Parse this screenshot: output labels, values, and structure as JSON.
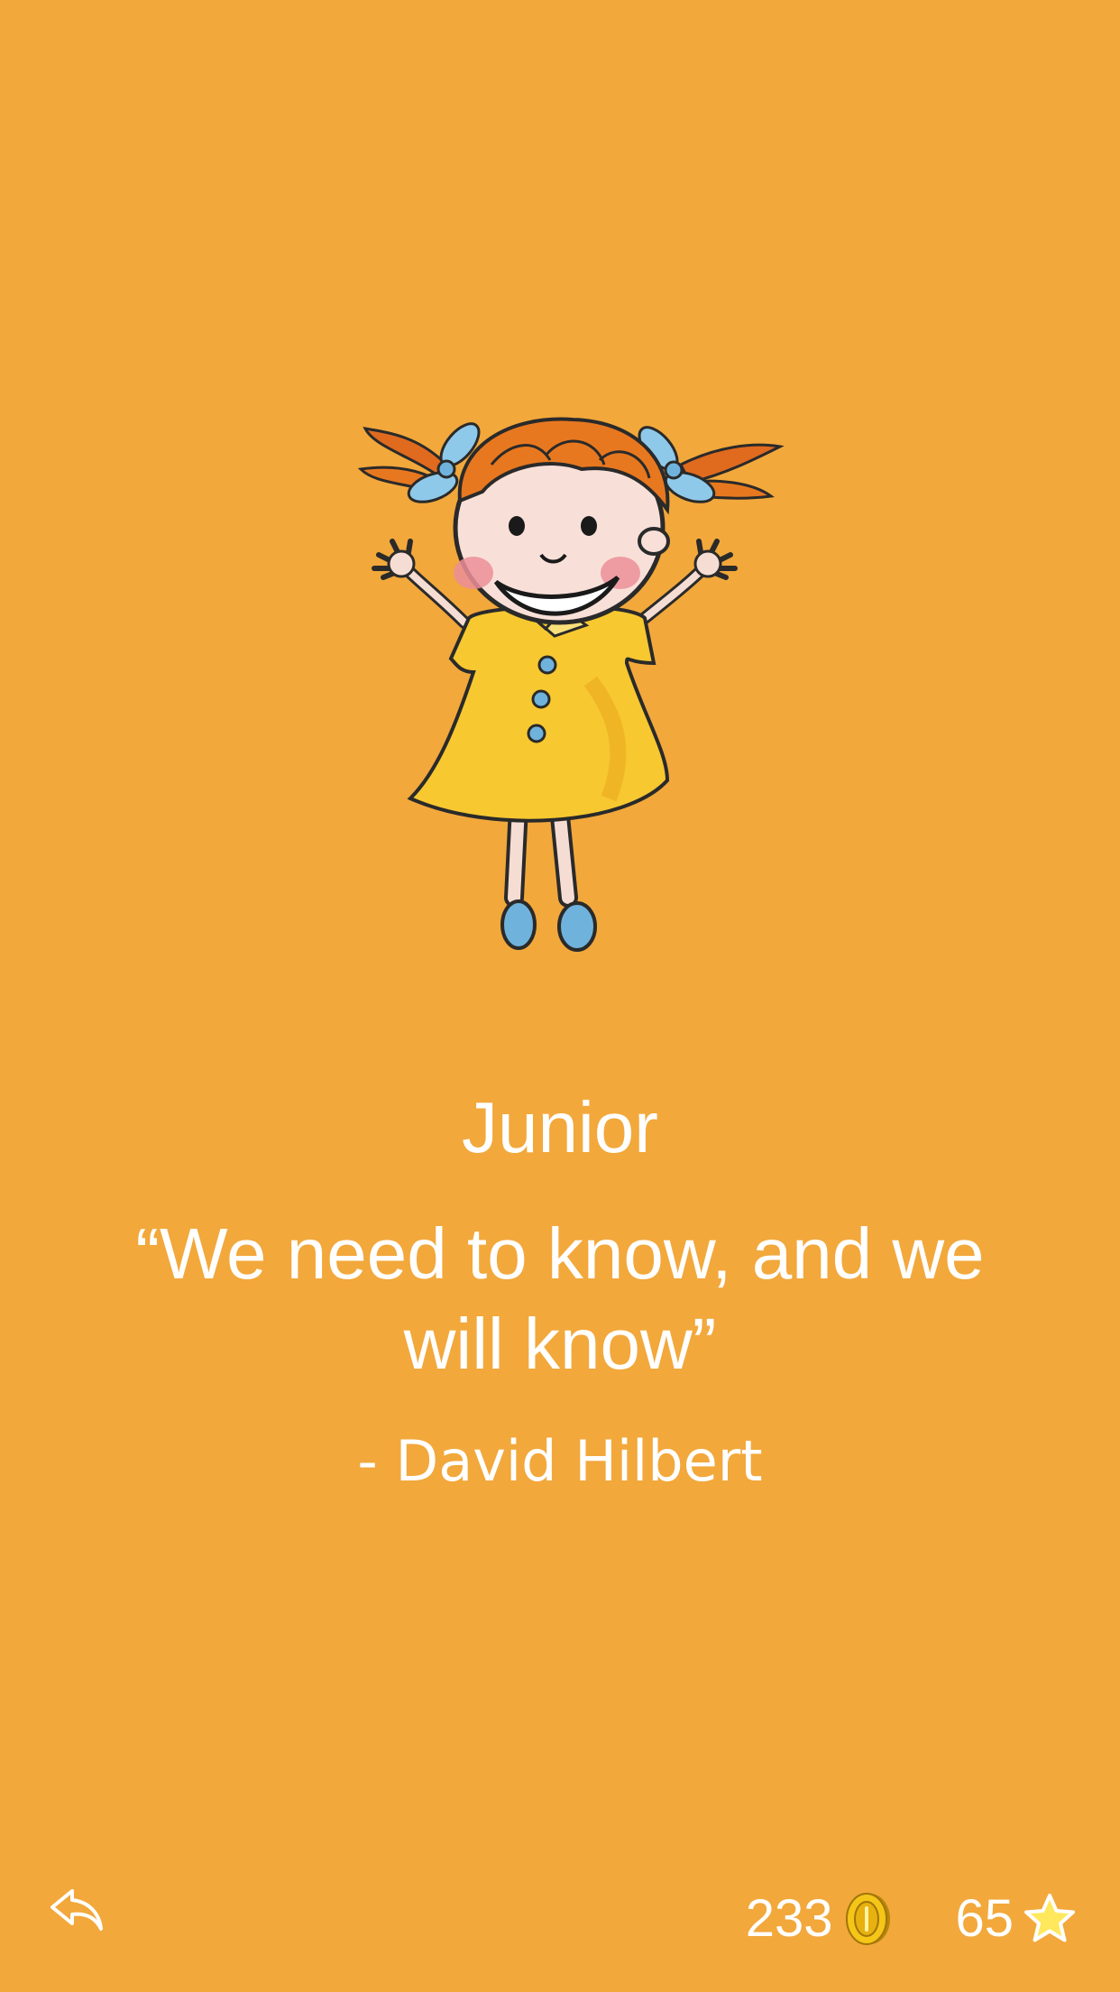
{
  "level": {
    "title": "Junior"
  },
  "quote": {
    "text": "“We need to know, and we will know”",
    "author": "- David Hilbert"
  },
  "footer": {
    "back_icon": "reply-arrow-icon",
    "coins": "233",
    "coin_icon": "gold-coin-icon",
    "stars": "65",
    "star_icon": "star-icon"
  },
  "colors": {
    "background": "#F2A83B",
    "text": "#FFFFFF"
  }
}
